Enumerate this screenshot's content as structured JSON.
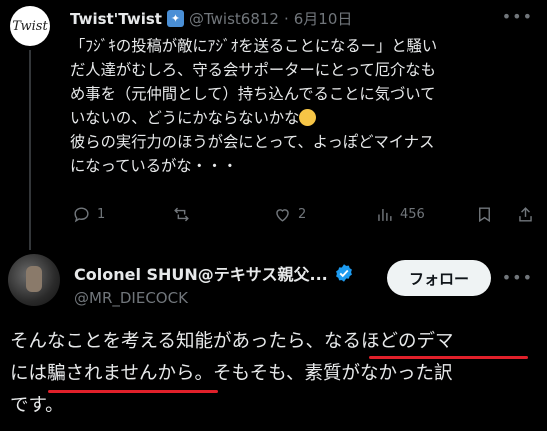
{
  "tweet1": {
    "avatar_text": "Twist",
    "name": "Twist'Twist",
    "handle": "@Twist6812",
    "date": "6月10日",
    "lines": [
      "「ﾌｼﾞｷの投稿が敵にｱｼﾞｵを送ることになるー」と騒い",
      "だ人達がむしろ、守る会サポーターにとって厄介なも",
      "め事を（元仲間として）持ち込んでることに気づいて",
      "いないの、どうにかならないかな",
      "彼らの実行力のほうが会にとって、よっぽどマイナス",
      "になっているがな・・・"
    ],
    "reply_count": "1",
    "like_count": "2",
    "view_count": "456"
  },
  "tweet2": {
    "name": "Colonel SHUN@テキサス親父...",
    "handle": "@MR_DIECOCK",
    "follow_label": "フォロー",
    "lines": [
      "そんなことを考える知能があったら、なるほどのデマ",
      "には騙されませんから。そもそも、素質がなかった訳",
      "です。"
    ],
    "highlight_color": "#e0202a"
  }
}
